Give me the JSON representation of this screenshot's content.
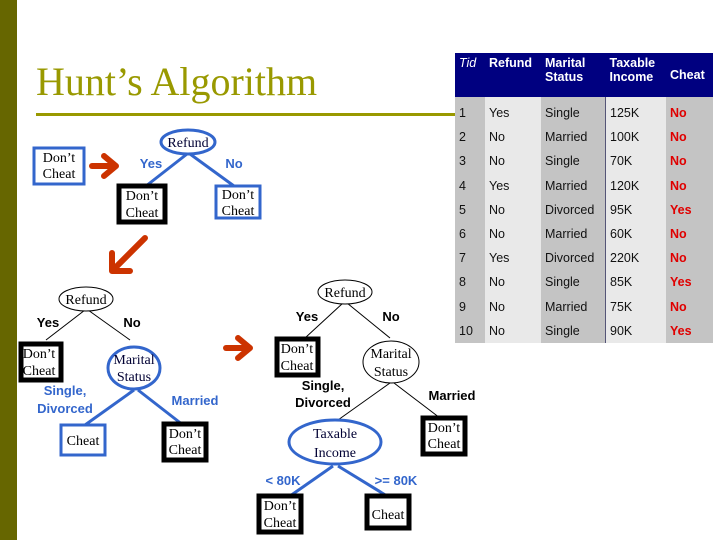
{
  "slide": {
    "title": "Hunt’s Algorithm",
    "colors": {
      "accent_bar": "#666600",
      "title": "#999900",
      "node_blue": "#3366cc",
      "arrow": "#cc3300",
      "table_header": "#000080",
      "cheat_text": "#e00000"
    }
  },
  "table": {
    "headers": [
      "Tid",
      "Refund",
      "Marital Status",
      "Taxable Income",
      "Cheat"
    ],
    "header_lines": [
      [
        "Tid"
      ],
      [
        "Refund"
      ],
      [
        "Marital",
        "Status"
      ],
      [
        "Taxable",
        "Income"
      ],
      [
        "Cheat"
      ]
    ],
    "rows": [
      [
        "1",
        "Yes",
        "Single",
        "125K",
        "No"
      ],
      [
        "2",
        "No",
        "Married",
        "100K",
        "No"
      ],
      [
        "3",
        "No",
        "Single",
        "70K",
        "No"
      ],
      [
        "4",
        "Yes",
        "Married",
        "120K",
        "No"
      ],
      [
        "5",
        "No",
        "Divorced",
        "95K",
        "Yes"
      ],
      [
        "6",
        "No",
        "Married",
        "60K",
        "No"
      ],
      [
        "7",
        "Yes",
        "Divorced",
        "220K",
        "No"
      ],
      [
        "8",
        "No",
        "Single",
        "85K",
        "Yes"
      ],
      [
        "9",
        "No",
        "Married",
        "75K",
        "No"
      ],
      [
        "10",
        "No",
        "Single",
        "90K",
        "Yes"
      ]
    ]
  },
  "trees": {
    "step1": {
      "leaf": [
        "Don’t",
        "Cheat"
      ]
    },
    "step2": {
      "root": "Refund",
      "edge_yes": "Yes",
      "edge_no": "No",
      "leaf_yes": [
        "Don’t",
        "Cheat"
      ],
      "leaf_no": [
        "Don’t",
        "Cheat"
      ]
    },
    "step3": {
      "root": "Refund",
      "edge_yes": "Yes",
      "edge_no": "No",
      "leaf_yes": [
        "Don’t",
        "Cheat"
      ],
      "node_marital": [
        "Marital",
        "Status"
      ],
      "edge_single": [
        "Single,",
        "Divorced"
      ],
      "edge_married": "Married",
      "leaf_single": "Cheat",
      "leaf_married": [
        "Don’t",
        "Cheat"
      ]
    },
    "step4": {
      "root": "Refund",
      "edge_yes": "Yes",
      "edge_no": "No",
      "leaf_yes": [
        "Don’t",
        "Cheat"
      ],
      "node_marital": [
        "Marital",
        "Status"
      ],
      "edge_single": [
        "Single,",
        "Divorced"
      ],
      "edge_married": "Married",
      "leaf_married": [
        "Don’t",
        "Cheat"
      ],
      "node_income": [
        "Taxable",
        "Income"
      ],
      "edge_lt": "< 80K",
      "edge_ge": ">= 80K",
      "leaf_lt": [
        "Don’t",
        "Cheat"
      ],
      "leaf_ge": "Cheat"
    }
  }
}
